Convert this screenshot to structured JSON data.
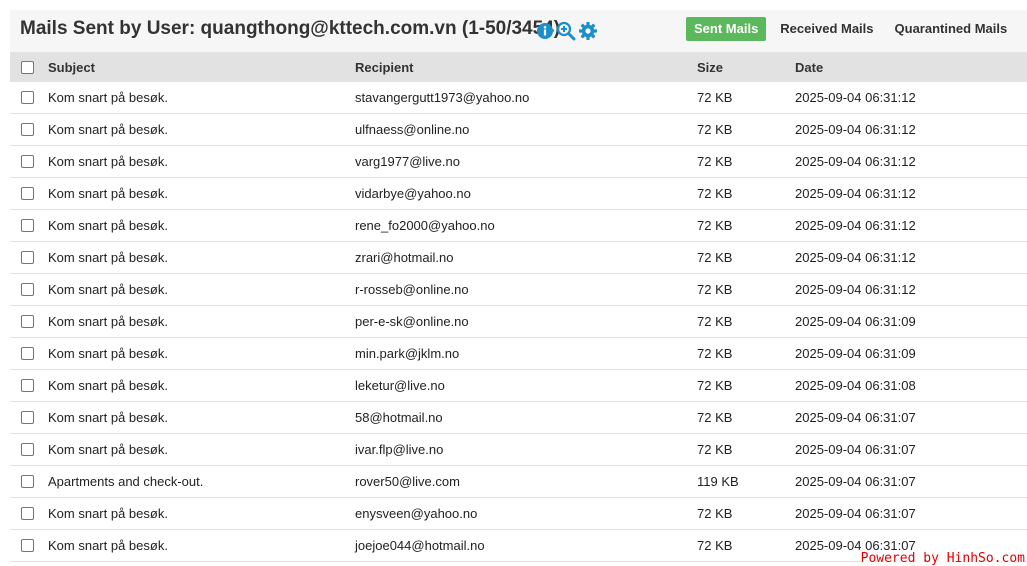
{
  "header": {
    "title": "Mails Sent by User: quangthong@kttech.com.vn (1-50/3454)",
    "icons": [
      "info-icon",
      "zoom-in-icon",
      "gear-icon"
    ]
  },
  "tabs": [
    {
      "label": "Sent Mails",
      "active": true
    },
    {
      "label": "Received Mails",
      "active": false
    },
    {
      "label": "Quarantined Mails",
      "active": false
    }
  ],
  "table": {
    "columns": {
      "subject": "Subject",
      "recipient": "Recipient",
      "size": "Size",
      "date": "Date"
    },
    "rows": [
      {
        "subject": "Kom snart på besøk.",
        "recipient": "stavangergutt1973@yahoo.no",
        "size": "72 KB",
        "date": "2025-09-04 06:31:12"
      },
      {
        "subject": "Kom snart på besøk.",
        "recipient": "ulfnaess@online.no",
        "size": "72 KB",
        "date": "2025-09-04 06:31:12"
      },
      {
        "subject": "Kom snart på besøk.",
        "recipient": "varg1977@live.no",
        "size": "72 KB",
        "date": "2025-09-04 06:31:12"
      },
      {
        "subject": "Kom snart på besøk.",
        "recipient": "vidarbye@yahoo.no",
        "size": "72 KB",
        "date": "2025-09-04 06:31:12"
      },
      {
        "subject": "Kom snart på besøk.",
        "recipient": "rene_fo2000@yahoo.no",
        "size": "72 KB",
        "date": "2025-09-04 06:31:12"
      },
      {
        "subject": "Kom snart på besøk.",
        "recipient": "zrari@hotmail.no",
        "size": "72 KB",
        "date": "2025-09-04 06:31:12"
      },
      {
        "subject": "Kom snart på besøk.",
        "recipient": "r-rosseb@online.no",
        "size": "72 KB",
        "date": "2025-09-04 06:31:12"
      },
      {
        "subject": "Kom snart på besøk.",
        "recipient": "per-e-sk@online.no",
        "size": "72 KB",
        "date": "2025-09-04 06:31:09"
      },
      {
        "subject": "Kom snart på besøk.",
        "recipient": "min.park@jklm.no",
        "size": "72 KB",
        "date": "2025-09-04 06:31:09"
      },
      {
        "subject": "Kom snart på besøk.",
        "recipient": "leketur@live.no",
        "size": "72 KB",
        "date": "2025-09-04 06:31:08"
      },
      {
        "subject": "Kom snart på besøk.",
        "recipient": "58@hotmail.no",
        "size": "72 KB",
        "date": "2025-09-04 06:31:07"
      },
      {
        "subject": "Kom snart på besøk.",
        "recipient": "ivar.flp@live.no",
        "size": "72 KB",
        "date": "2025-09-04 06:31:07"
      },
      {
        "subject": "Apartments and check-out.",
        "recipient": "rover50@live.com",
        "size": "119 KB",
        "date": "2025-09-04 06:31:07"
      },
      {
        "subject": "Kom snart på besøk.",
        "recipient": "enysveen@yahoo.no",
        "size": "72 KB",
        "date": "2025-09-04 06:31:07"
      },
      {
        "subject": "Kom snart på besøk.",
        "recipient": "joejoe044@hotmail.no",
        "size": "72 KB",
        "date": "2025-09-04 06:31:07"
      }
    ]
  },
  "watermark": "Powered by HinhSo.com",
  "colors": {
    "accent": "#5cb85c",
    "icon": "#1a8fc9",
    "header_bg": "#e2e2e2",
    "watermark": "#e30000"
  }
}
